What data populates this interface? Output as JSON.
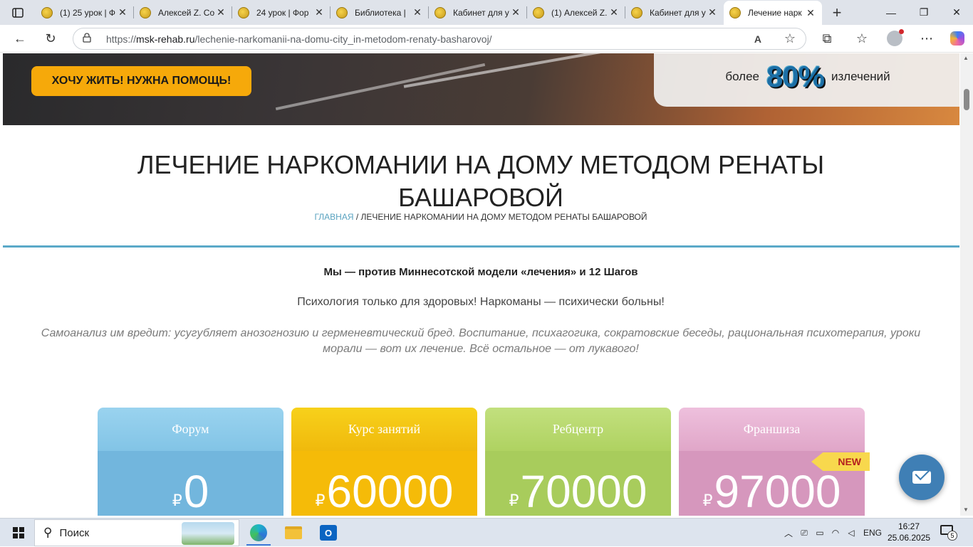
{
  "browser": {
    "tabs": [
      {
        "title": "(1) 25 урок | Ф",
        "active": false
      },
      {
        "title": "Алексей Z. Со",
        "active": false
      },
      {
        "title": "24 урок | Фор",
        "active": false
      },
      {
        "title": "Библиотека | ",
        "active": false
      },
      {
        "title": "Кабинет для у",
        "active": false
      },
      {
        "title": "(1) Алексей Z.",
        "active": false
      },
      {
        "title": "Кабинет для у",
        "active": false
      },
      {
        "title": "Лечение нарк",
        "active": true
      }
    ],
    "close_glyph": "✕",
    "new_tab_glyph": "+",
    "url_prefix": "https://",
    "url_host": "msk-rehab.ru",
    "url_path": "/lechenie-narkomanii-na-domu-city_in-metodom-renaty-basharovoj/"
  },
  "page": {
    "hero": {
      "cta_label": "ХОЧУ ЖИТЬ! НУЖНА ПОМОЩЬ!",
      "stat_pre": "более",
      "stat_value": "80%",
      "stat_post": "излечений"
    },
    "title": "ЛЕЧЕНИЕ НАРКОМАНИИ НА ДОМУ МЕТОДОМ РЕНАТЫ БАШАРОВОЙ",
    "breadcrumb": {
      "home": "ГЛАВНАЯ",
      "separator": " / ",
      "current": "ЛЕЧЕНИЕ НАРКОМАНИИ НА ДОМУ МЕТОДОМ РЕНАТЫ БАШАРОВОЙ"
    },
    "line1": "Мы — против Миннесотской модели «лечения» и 12 Шагов",
    "line2": "Психология только для здоровых! Наркоманы — психически больны!",
    "line3": "Самоанализ им вредит: усугубляет анозогнозию и герменевтический бред. Воспитание, психагогика, сократовские беседы, рациональная психотерапия, уроки морали — вот их лечение. Всё остальное — от лукавого!",
    "cards": [
      {
        "title": "Форум",
        "currency": "₽",
        "price": "0",
        "color": "#72b6dd"
      },
      {
        "title": "Курс занятий",
        "currency": "₽",
        "price": "60000",
        "color": "#f5bb08"
      },
      {
        "title": "Ребцентр",
        "currency": "₽",
        "price": "70000",
        "color": "#a8cc5c"
      },
      {
        "title": "Франшиза",
        "currency": "₽",
        "price": "97000",
        "color": "#d697bd"
      }
    ],
    "new_badge": "NEW"
  },
  "taskbar": {
    "search_placeholder": "Поиск",
    "language": "ENG",
    "time": "16:27",
    "date": "25.06.2025",
    "notification_count": "5"
  },
  "icons": {
    "back": "←",
    "reload": "↻",
    "read_aloud": "A",
    "favorite": "☆",
    "extensions": "⧉",
    "favorites_bar": "☆",
    "more": "⋯",
    "minimize": "—",
    "maximize": "❐",
    "close": "✕"
  }
}
